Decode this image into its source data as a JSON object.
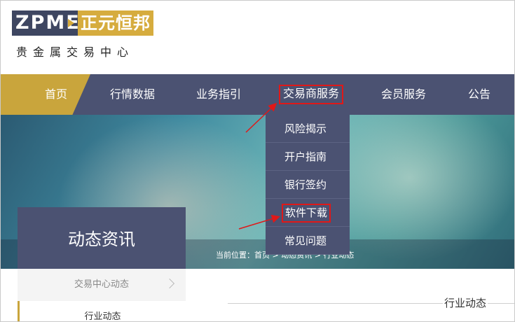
{
  "logo": {
    "en": "ZPME",
    "cn": "正元恒邦",
    "subtitle": "贵金属交易中心"
  },
  "nav": {
    "items": [
      {
        "label": "首页"
      },
      {
        "label": "行情数据"
      },
      {
        "label": "业务指引"
      },
      {
        "label": "交易商服务"
      },
      {
        "label": "会员服务"
      },
      {
        "label": "公告"
      }
    ]
  },
  "dropdown": {
    "items": [
      {
        "label": "风险揭示"
      },
      {
        "label": "开户指南"
      },
      {
        "label": "银行签约"
      },
      {
        "label": "软件下载"
      },
      {
        "label": "常见问题"
      }
    ]
  },
  "banner": {
    "section_title": "动态资讯",
    "breadcrumb": "当前位置：首页 > 动态资讯 > 行业动态"
  },
  "sidebar": {
    "items": [
      {
        "label": "交易中心动态"
      },
      {
        "label": "行业动态"
      }
    ]
  },
  "content": {
    "title": "行业动态"
  },
  "colors": {
    "nav_bg": "#4b5272",
    "accent_gold": "#c9a53c",
    "highlight_red": "#e01818"
  }
}
